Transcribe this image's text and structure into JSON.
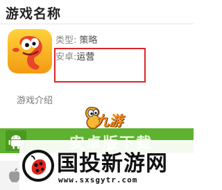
{
  "header": {
    "title": "游戏名称"
  },
  "app": {
    "icon": "cartoon-character-icon",
    "type_label": "类型:",
    "type_value": "策略",
    "android_label": "安卓:",
    "android_value": "运营"
  },
  "section": {
    "title": "游戏介绍"
  },
  "download": {
    "android_label": "安卓版下载",
    "android_icon": "android-icon",
    "ios_icon": "apple-icon",
    "accent": "#5fb130"
  },
  "watermarks": {
    "logo_text": "九游",
    "site_name": "国投新游网",
    "site_url": "www.sxsgytr.com"
  },
  "colors": {
    "highlight_border": "#d9252b"
  }
}
